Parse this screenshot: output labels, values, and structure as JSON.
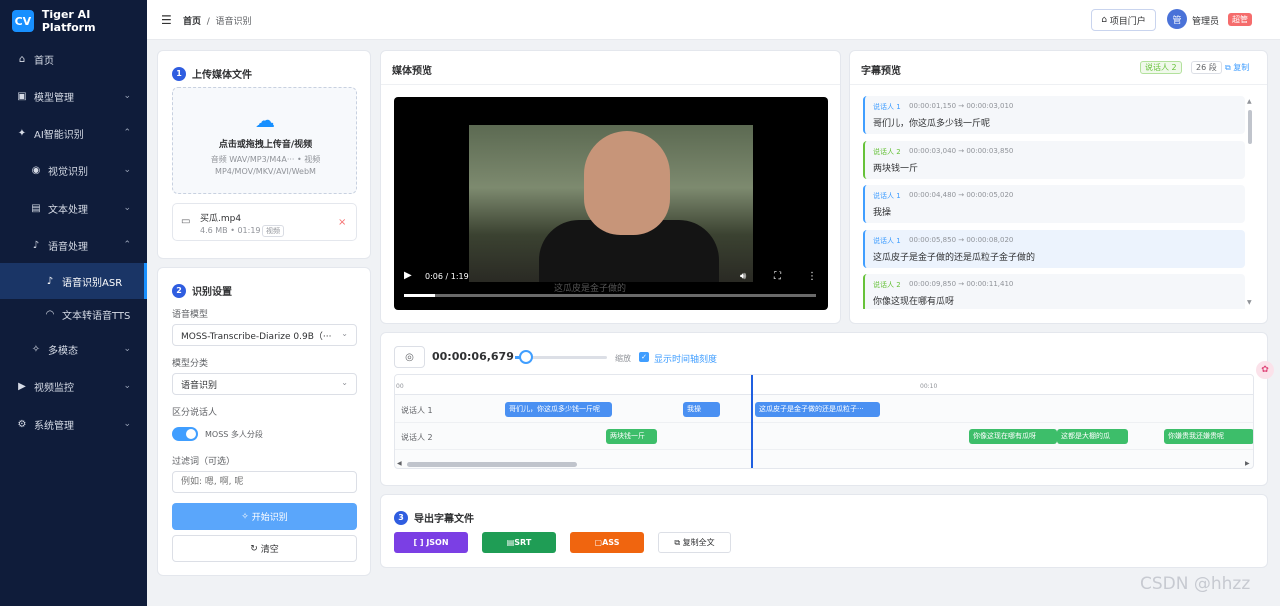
{
  "app": {
    "logo_mark": "CV",
    "name": "Tiger AI Platform"
  },
  "sidebar": {
    "items": [
      {
        "label": "首页",
        "icon": "home-icon"
      },
      {
        "label": "模型管理",
        "icon": "box-icon"
      },
      {
        "label": "AI智能识别",
        "icon": "ai-icon"
      },
      {
        "label": "视觉识别",
        "icon": "eye-icon"
      },
      {
        "label": "文本处理",
        "icon": "document-icon"
      },
      {
        "label": "语音处理",
        "icon": "microphone-icon"
      },
      {
        "label": "语音识别ASR",
        "icon": "microphone-icon"
      },
      {
        "label": "文本转语音TTS",
        "icon": "headphones-icon"
      },
      {
        "label": "多模态",
        "icon": "sparkle-icon"
      },
      {
        "label": "视频监控",
        "icon": "video-icon"
      },
      {
        "label": "系统管理",
        "icon": "gear-icon"
      }
    ]
  },
  "topbar": {
    "breadcrumb_home": "首页",
    "breadcrumb_sep": "/",
    "breadcrumb_current": "语音识别",
    "project_button": "项目门户",
    "avatar_text": "管",
    "user_name": "管理员",
    "user_badge": "超管"
  },
  "upload": {
    "step": "1",
    "title": "上传媒体文件",
    "drop_title": "点击或拖拽上传音/视频",
    "drop_sub": "音频 WAV/MP3/M4A··· • 视频 MP4/MOV/MKV/AVI/WebM",
    "file_name": "买瓜.mp4",
    "file_meta": "4.6 MB • 01:19",
    "file_tag": "视频"
  },
  "settings": {
    "step": "2",
    "title": "识别设置",
    "model_label": "语音模型",
    "model_value": "MOSS-Transcribe-Diarize 0.9B（···",
    "category_label": "模型分类",
    "category_value": "语音识别",
    "diarize_label": "区分说话人",
    "toggle_label": "MOSS 多人分段",
    "filter_label": "过滤词（可选）",
    "filter_placeholder": "例如: 嗯, 啊, 呢",
    "start_button": "开始识别",
    "clear_button": "清空"
  },
  "preview": {
    "title": "媒体预览",
    "time": "0:06 / 1:19",
    "progress": 0.076,
    "burned_subtitle": "这瓜皮是金子做的"
  },
  "subtitles": {
    "title": "字幕预览",
    "speaker_tag": "说话人 2",
    "count": "26 段",
    "copy": "复制",
    "items": [
      {
        "speaker": "说话人 1",
        "time": "00:00:01,150 → 00:00:03,010",
        "text": "哥们儿，你这瓜多少钱一斤呢"
      },
      {
        "speaker": "说话人 2",
        "time": "00:00:03,040 → 00:00:03,850",
        "text": "两块钱一斤"
      },
      {
        "speaker": "说话人 1",
        "time": "00:00:04,480 → 00:00:05,020",
        "text": "我操"
      },
      {
        "speaker": "说话人 1",
        "time": "00:00:05,850 → 00:00:08,020",
        "text": "这瓜皮子是金子做的还是瓜粒子金子做的"
      },
      {
        "speaker": "说话人 2",
        "time": "00:00:09,850 → 00:00:11,410",
        "text": "你像这现在哪有瓜呀"
      }
    ]
  },
  "timeline": {
    "current": "00:00:06,679",
    "zoom_label": "缩放",
    "zoom_level": 0.13,
    "show_ticks_label": "显示时间轴刻度",
    "tick_0": "00",
    "tick_10": "00:10",
    "row1_label": "说话人 1",
    "row2_label": "说话人 2",
    "segments_row1": [
      "哥们儿，你这瓜多少钱一斤呢",
      "我操",
      "这瓜皮子是金子做的还是瓜粒子···"
    ],
    "segments_row2": [
      "两块钱一斤",
      "你像这现在哪有瓜呀",
      "这都是大棚的瓜",
      "你嫌贵我还嫌贵呢"
    ]
  },
  "export": {
    "step": "3",
    "title": "导出字幕文件",
    "json": "[ ] JSON",
    "srt": "SRT",
    "ass": "ASS",
    "copy_all": "复制全文",
    "colors": {
      "json": "#7b3fe4",
      "srt": "#1f9d55",
      "ass": "#f0650f"
    }
  },
  "watermark": "CSDN @hhzz"
}
